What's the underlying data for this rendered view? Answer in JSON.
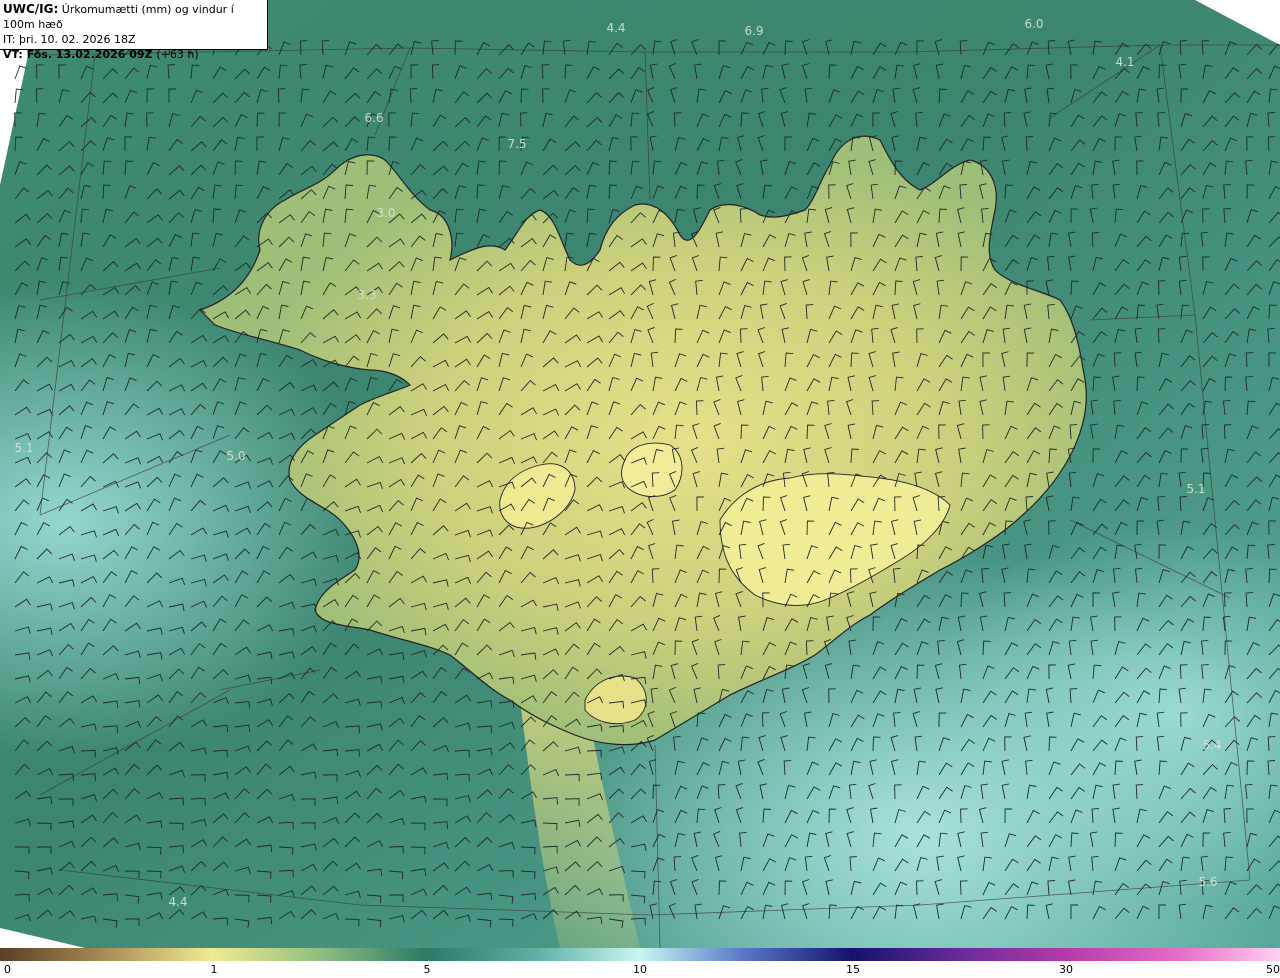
{
  "header": {
    "product": "UWC/IG:",
    "title": "Úrkomumætti (mm) og vindur í 100m hæð",
    "init_time": "IT: þri. 10. 02. 2026 18Z",
    "valid_time": "VT: Fös. 13.02.2026 09Z",
    "lead": "(+63 h)"
  },
  "map_labels": [
    "4.4",
    "6.9",
    "6.0",
    "4.1",
    "6.6",
    "7.5",
    "3.0",
    "3.3",
    "5.1",
    "5.1",
    "5.4",
    "5.6",
    "4.4",
    "5.0"
  ],
  "colorbar": {
    "ticks": [
      "0",
      "1",
      "5",
      "10",
      "15",
      "30",
      "50"
    ],
    "colors": [
      "#6b4a2a",
      "#c4a767",
      "#f0e68c",
      "#2e7d6a",
      "#3a8f86",
      "#bff5f5",
      "#1c1c7a",
      "#d23fb8",
      "#ff99dd"
    ]
  },
  "palette": {
    "land": "#d9d47a",
    "sea": "#3a8a72",
    "sea_light": "#7fc6c1",
    "grid": "#333333",
    "coast": "#222222"
  }
}
